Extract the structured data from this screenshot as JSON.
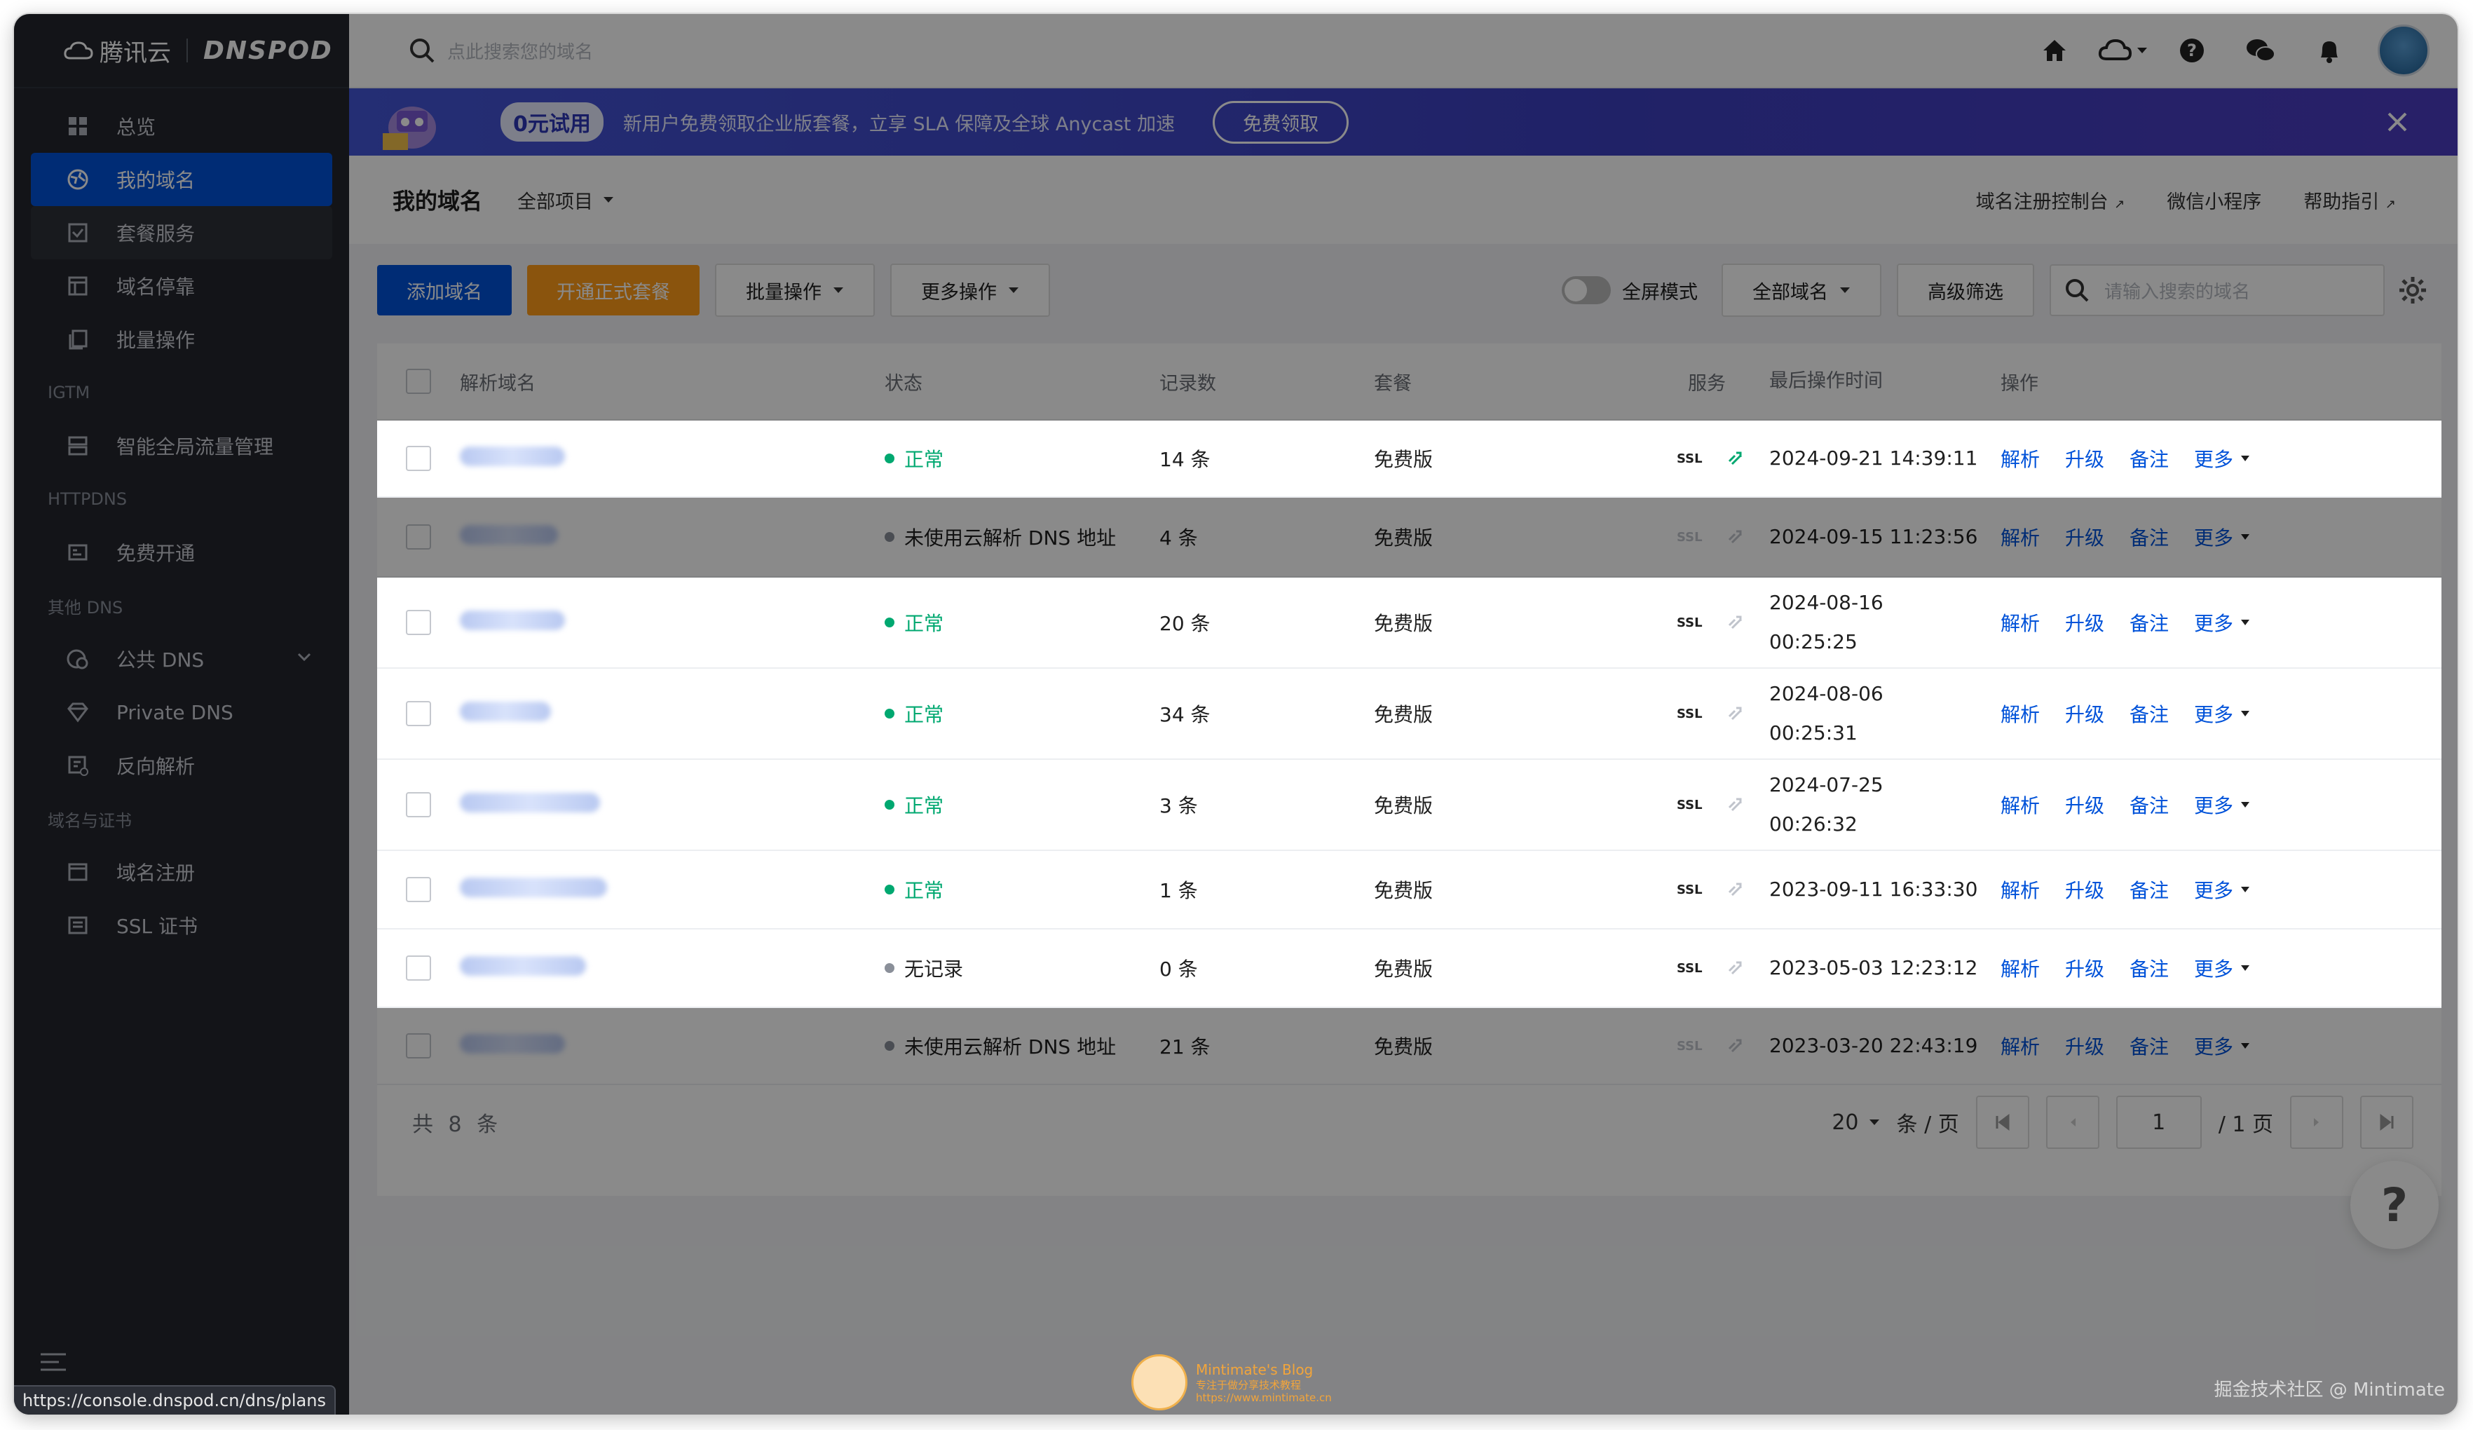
{
  "brand": {
    "cloud_text": "腾讯云",
    "product": "DNSPOD"
  },
  "sidebar": {
    "items": [
      {
        "label": "总览",
        "icon": "dashboard-icon"
      },
      {
        "label": "我的域名",
        "icon": "globe-icon"
      },
      {
        "label": "套餐服务",
        "icon": "package-icon"
      },
      {
        "label": "域名停靠",
        "icon": "parking-icon"
      },
      {
        "label": "批量操作",
        "icon": "batch-icon"
      }
    ],
    "group_igtm": "IGTM",
    "igtm_item": "智能全局流量管理",
    "group_httpdns": "HTTPDNS",
    "httpdns_item": "免费开通",
    "group_other": "其他 DNS",
    "public_dns": "公共 DNS",
    "private_dns": "Private DNS",
    "reverse": "反向解析",
    "group_domain_cert": "域名与证书",
    "domain_register": "域名注册",
    "ssl_cert": "SSL 证书"
  },
  "status_url": "https://console.dnspod.cn/dns/plans",
  "topbar": {
    "search_placeholder": "点此搜索您的域名"
  },
  "banner": {
    "badge": "0元试用",
    "text": "新用户免费领取企业版套餐，立享 SLA 保障及全球 Anycast 加速",
    "button": "免费领取"
  },
  "header": {
    "title": "我的域名",
    "project": "全部项目",
    "links": [
      "域名注册控制台",
      "微信小程序",
      "帮助指引"
    ]
  },
  "toolbar": {
    "add": "添加域名",
    "upgrade": "开通正式套餐",
    "batch": "批量操作",
    "more": "更多操作",
    "fullscreen": "全屏模式",
    "all_domains": "全部域名",
    "advanced": "高级筛选",
    "search_placeholder": "请输入搜索的域名"
  },
  "table": {
    "headers": [
      "解析域名",
      "状态",
      "记录数",
      "套餐",
      "服务",
      "最后操作时间",
      "操作"
    ],
    "service_label": "SSL",
    "ops": [
      "解析",
      "升级",
      "备注",
      "更多"
    ],
    "rows": [
      {
        "status": "正常",
        "count": "14 条",
        "plan": "免费版",
        "time1": "2024-09-21 14:39:11",
        "time2": ""
      },
      {
        "status": "未使用云解析 DNS 地址",
        "count": "4 条",
        "plan": "免费版",
        "time1": "2024-09-15 11:23:56",
        "time2": ""
      },
      {
        "status": "正常",
        "count": "20 条",
        "plan": "免费版",
        "time1": "2024-08-16",
        "time2": "00:25:25"
      },
      {
        "status": "正常",
        "count": "34 条",
        "plan": "免费版",
        "time1": "2024-08-06",
        "time2": "00:25:31"
      },
      {
        "status": "正常",
        "count": "3 条",
        "plan": "免费版",
        "time1": "2024-07-25",
        "time2": "00:26:32"
      },
      {
        "status": "正常",
        "count": "1 条",
        "plan": "免费版",
        "time1": "2023-09-11 16:33:30",
        "time2": ""
      },
      {
        "status": "无记录",
        "count": "0 条",
        "plan": "免费版",
        "time1": "2023-05-03 12:23:12",
        "time2": ""
      },
      {
        "status": "未使用云解析 DNS 地址",
        "count": "21 条",
        "plan": "免费版",
        "time1": "2023-03-20 22:43:19",
        "time2": ""
      }
    ]
  },
  "footer": {
    "total": "共 8 条",
    "page_size": "20",
    "per_page": "条 / 页",
    "page": "1",
    "pages": "/ 1 页"
  },
  "help_fab": "?",
  "watermark": {
    "title": "Mintimate's Blog",
    "subtitle": "专注于做分享技术教程",
    "url": "https://www.mintimate.cn"
  },
  "juejin": "掘金技术社区 @ Mintimate",
  "colors": {
    "primary": "#0052d9",
    "orange": "#ff9c19",
    "success": "#00a870",
    "sidebar": "#23262e"
  }
}
